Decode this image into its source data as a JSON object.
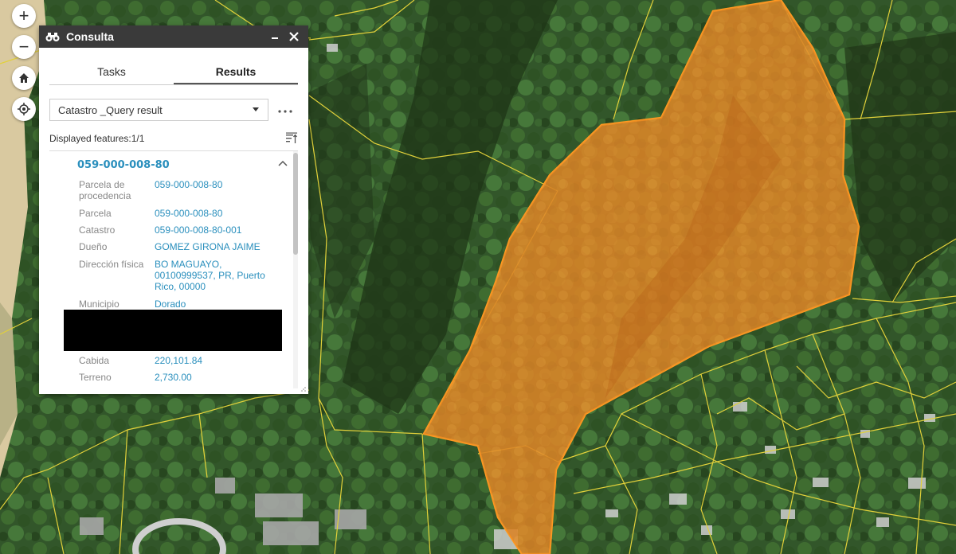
{
  "map": {
    "zoom_in": "+",
    "zoom_out": "−"
  },
  "panel": {
    "title": "Consulta",
    "tabs": [
      {
        "label": "Tasks",
        "active": false
      },
      {
        "label": "Results",
        "active": true
      }
    ],
    "layer_select": "Catastro _Query result",
    "displayed_features": "Displayed features:1/1",
    "feature": {
      "title": "059-000-008-80",
      "attributes": [
        {
          "label": "Parcela de procedencia",
          "value": "059-000-008-80"
        },
        {
          "label": "Parcela",
          "value": "059-000-008-80"
        },
        {
          "label": "Catastro",
          "value": "059-000-008-80-001"
        },
        {
          "label": "Dueño",
          "value": "GOMEZ GIRONA JAIME"
        },
        {
          "label": "Dirección física",
          "value": "BO MAGUAYO, 00100999537, PR, Puerto Rico, 00000"
        },
        {
          "label": "Municipio",
          "value": "Dorado"
        },
        {
          "label": "Cabida",
          "value": "220,101.84"
        },
        {
          "label": "Terreno",
          "value": "2,730.00"
        }
      ]
    }
  },
  "colors": {
    "parcel_highlight": "#e8912a",
    "parcel_lines": "#e2d13a",
    "accent_blue": "#2a8fbd",
    "header": "#3a3a3a"
  }
}
